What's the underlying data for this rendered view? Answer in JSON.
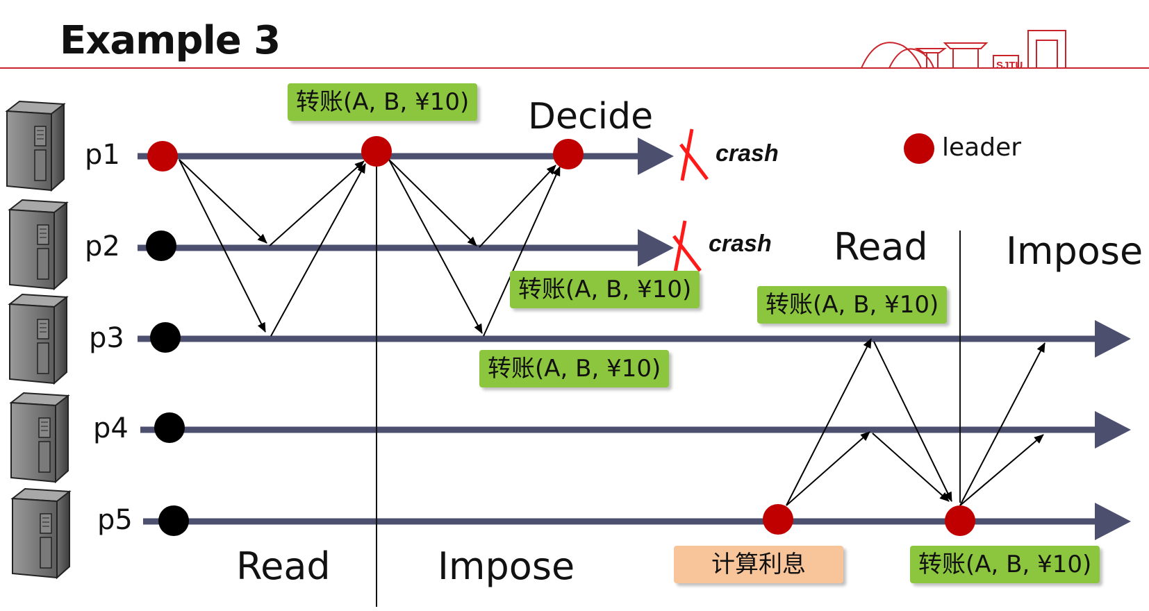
{
  "title": "Example 3",
  "logo_text": "SJTU",
  "processes": [
    "p1",
    "p2",
    "p3",
    "p4",
    "p5"
  ],
  "crash_label": "crash",
  "decide_label": "Decide",
  "legend": {
    "label": "leader",
    "color": "#c00000"
  },
  "phases": {
    "read_bottom": "Read",
    "impose_bottom": "Impose",
    "read_top": "Read",
    "impose_top": "Impose"
  },
  "messages": {
    "m1": "转账(A, B, ¥10)",
    "m2": "转账(A, B, ¥10)",
    "m3": "转账(A, B, ¥10)",
    "m4": "转账(A, B, ¥10)",
    "m5": "转账(A, B, ¥10)",
    "interest": "计算利息"
  },
  "colors": {
    "timeline": "#4d4f6e",
    "pill_green": "#8cc63f",
    "pill_orange": "#f8c49a",
    "accent_red": "#cc2229"
  }
}
